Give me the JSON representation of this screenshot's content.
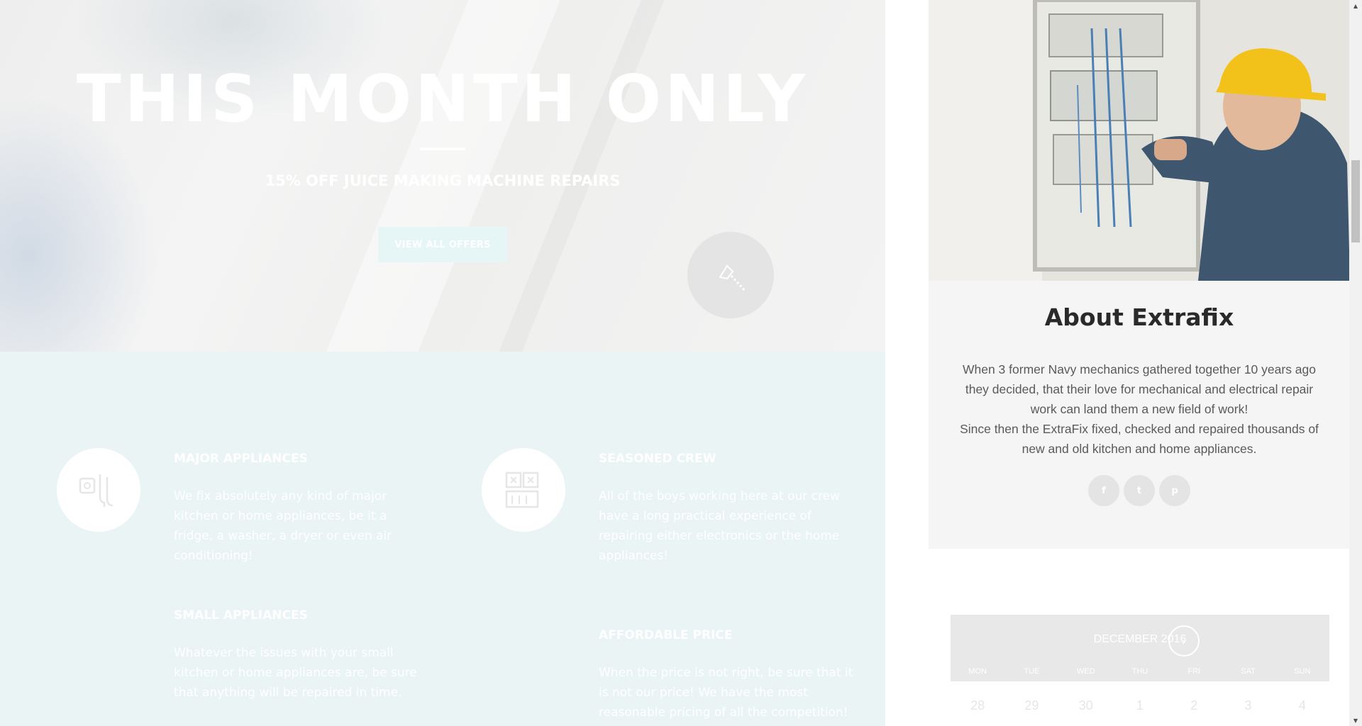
{
  "hero": {
    "title": "THIS MONTH ONLY",
    "subtitle": "15% OFF JUICE MAKING MACHINE REPAIRS",
    "button_label": "VIEW ALL OFFERS"
  },
  "features": [
    {
      "title": "MAJOR APPLIANCES",
      "text": "We fix absolutely any kind of major kitchen or home appliances, be it a fridge, a washer, a dryer or even air conditioning!",
      "icon": "appliance-plug-icon"
    },
    {
      "title": "SEASONED CREW",
      "text": "All of the boys working here at our crew have a long practical experience of repairing either electronics or the home appliances!",
      "icon": "control-panel-icon"
    },
    {
      "title": "SMALL APPLIANCES",
      "text": "Whatever the issues with your small kitchen or home appliances are, be sure that anything will be repaired in time."
    },
    {
      "title": "AFFORDABLE PRICE",
      "text": "When the price is not right, be sure that it is not our price! We have the most reasonable pricing of all the competition!"
    }
  ],
  "about": {
    "title": "About Extrafix",
    "paragraph_1": "When 3 former Navy mechanics gathered together 10 years ago they decided, that their love for mechanical and electrical repair work can land them a new field of work!",
    "paragraph_2": "Since then the ExtraFix fixed, checked and repaired thousands of new and old kitchen and home appliances.",
    "social": [
      {
        "label": "f",
        "icon": "facebook-icon"
      },
      {
        "label": "t",
        "icon": "twitter-icon"
      },
      {
        "label": "p",
        "icon": "pinterest-icon"
      }
    ]
  },
  "calendar": {
    "month_label": "DECEMBER 2016",
    "next_label": "›",
    "weekdays": [
      "MON",
      "TUE",
      "WED",
      "THU",
      "FRI",
      "SAT",
      "SUN"
    ],
    "first_row": [
      "28",
      "29",
      "30",
      "1",
      "2",
      "3",
      "4"
    ]
  },
  "scrollbar": {
    "up_glyph": "▲",
    "down_glyph": "▼"
  },
  "colors": {
    "features_bg": "#eaf4f4",
    "about_bg": "#f5f5f5",
    "title_text": "#2a2a2a",
    "body_text": "#5a5a5a"
  }
}
